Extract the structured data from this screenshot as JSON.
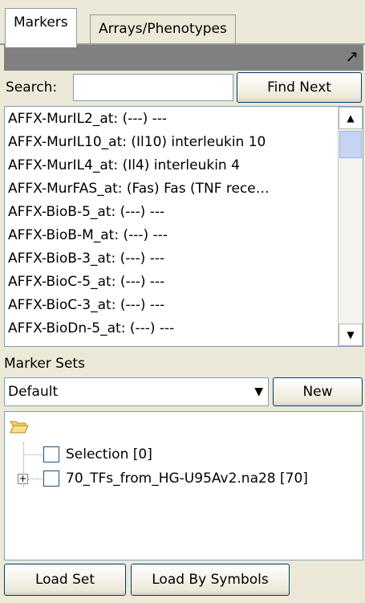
{
  "tabs": [
    {
      "label": "Markers",
      "active": true
    },
    {
      "label": "Arrays/Phenotypes",
      "active": false
    }
  ],
  "title_strip": {
    "icon": "maximize-arrow-icon",
    "glyph": "↗"
  },
  "search": {
    "label": "Search:",
    "value": "",
    "find_next_label": "Find Next"
  },
  "markers": [
    "AFFX-MurIL2_at: (---) ---",
    "AFFX-MurIL10_at: (Il10) interleukin 10",
    "AFFX-MurIL4_at: (Il4) interleukin 4",
    "AFFX-MurFAS_at: (Fas) Fas (TNF rece…",
    "AFFX-BioB-5_at: (---) ---",
    "AFFX-BioB-M_at: (---) ---",
    "AFFX-BioB-3_at: (---) ---",
    "AFFX-BioC-5_at: (---) ---",
    "AFFX-BioC-3_at: (---) ---",
    "AFFX-BioDn-5_at: (---) ---"
  ],
  "marker_sets": {
    "label": "Marker Sets",
    "selected": "Default",
    "new_label": "New",
    "tree": [
      {
        "label": "Selection [0]",
        "checked": false,
        "expandable": false
      },
      {
        "label": "70_TFs_from_HG-U95Av2.na28 [70]",
        "checked": false,
        "expandable": true
      }
    ]
  },
  "buttons": {
    "load_set": "Load Set",
    "load_by_symbols": "Load By Symbols"
  },
  "colors": {
    "panel": "#ece9d8",
    "title_strip": "#808080",
    "border": "#7f9db9",
    "folder": "#f5d66b"
  }
}
